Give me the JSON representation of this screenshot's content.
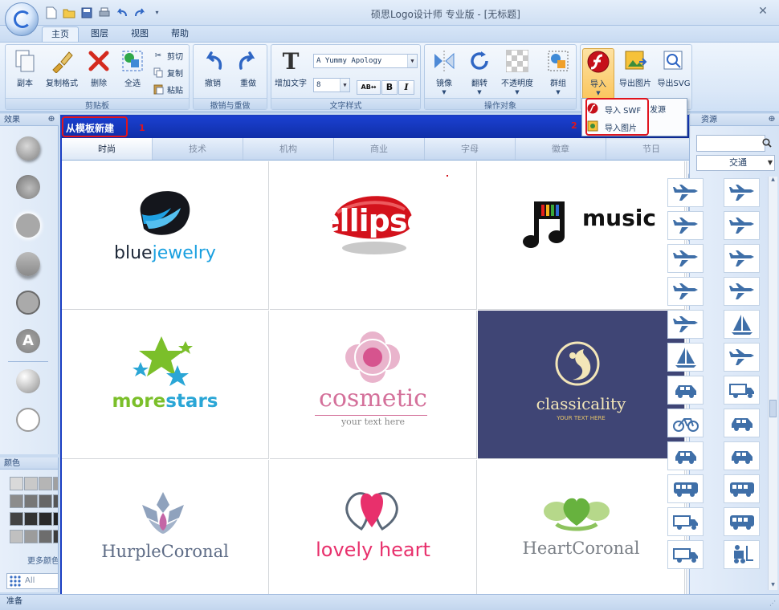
{
  "window": {
    "title": "硕思Logo设计师 专业版 - [无标题]"
  },
  "tabs": [
    "主页",
    "图层",
    "视图",
    "帮助"
  ],
  "ribbon": {
    "clipboard": {
      "label": "剪贴板",
      "copy_obj": "副本",
      "format_painter": "复制格式",
      "delete": "删除",
      "select_all": "全选",
      "cut": "剪切",
      "copy": "复制",
      "paste": "粘贴"
    },
    "undo_redo": {
      "label": "撤销与重做",
      "undo": "撤销",
      "redo": "重做"
    },
    "text_style": {
      "label": "文字样式",
      "add_text": "增加文字",
      "font": "A Yummy Apology",
      "size": "8",
      "bold": "B",
      "italic": "I"
    },
    "operate": {
      "label": "操作对象",
      "mirror": "镜像",
      "flip": "翻转",
      "opacity": "不透明度"
    },
    "group": {
      "group": "群组"
    },
    "io": {
      "import": "导入",
      "export_image": "导出图片",
      "export_svg": "导出SVG"
    }
  },
  "import_menu": {
    "items": [
      "导入 SWF",
      "导入图片"
    ]
  },
  "callouts": [
    "1",
    "2"
  ],
  "left_panel": {
    "effects_title": "效果",
    "color_title": "颜色",
    "more_colors": "更多颜色",
    "all_label": "All"
  },
  "document": {
    "title": "从模板新建",
    "categories": [
      "时尚",
      "技术",
      "机构",
      "商业",
      "字母",
      "徽章",
      "节日"
    ],
    "active_category": "时尚"
  },
  "templates": [
    {
      "name_a": "blue",
      "name_b": "jewelry"
    },
    {
      "name": "ellipse"
    },
    {
      "name": "music"
    },
    {
      "name_a": "more",
      "name_b": "stars"
    },
    {
      "name": "cosmetic",
      "tagline": "your text here"
    },
    {
      "name": "classicality",
      "tagline": "YOUR TEXT HERE"
    },
    {
      "name": "HurpleCoronal"
    },
    {
      "name": "lovely heart"
    },
    {
      "name": "HeartCoronal"
    }
  ],
  "right_panel": {
    "title": "资源",
    "category": "交通",
    "partial_label": "发源"
  },
  "status": {
    "text": "准备"
  },
  "colors": {
    "accent_blue": "#1a3ec2",
    "callout_red": "#e0141e",
    "bluejewelry": "#1aa0e0",
    "morestars": "#7bbf2a",
    "cosmetic": "#d4709a",
    "lovely": "#e8306c",
    "dark_tile": "#3f4575"
  }
}
